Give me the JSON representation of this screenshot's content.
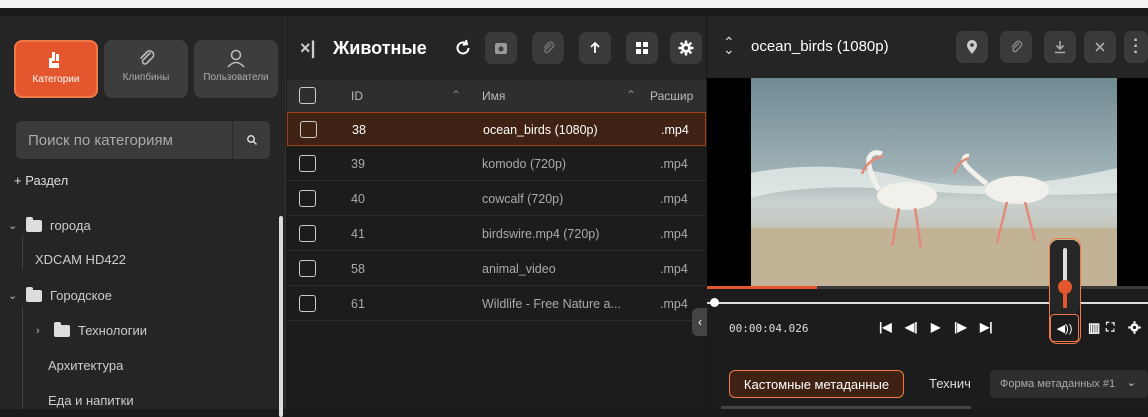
{
  "sidebar": {
    "nav": [
      {
        "label": "Категории",
        "icon": "categories-icon",
        "active": true
      },
      {
        "label": "Клипбины",
        "icon": "paperclip-icon",
        "active": false
      },
      {
        "label": "Пользователи",
        "icon": "user-icon",
        "active": false
      }
    ],
    "search_placeholder": "Поиск по категориям",
    "add_section": "+ Раздел",
    "tree": [
      {
        "label": "города",
        "expanded": true
      },
      {
        "label": "XDCAM HD422"
      },
      {
        "label": "Городское",
        "expanded": true
      },
      {
        "label": "Технологии",
        "expanded": false
      },
      {
        "label": "Архитектура"
      },
      {
        "label": "Еда и напитки"
      }
    ]
  },
  "middle": {
    "title": "Животные",
    "columns": [
      "ID",
      "Имя",
      "Расшир"
    ],
    "rows": [
      {
        "id": "38",
        "name": "ocean_birds (1080p)",
        "ext": ".mp4",
        "selected": true
      },
      {
        "id": "39",
        "name": "komodo (720p)",
        "ext": ".mp4"
      },
      {
        "id": "40",
        "name": "cowcalf (720p)",
        "ext": ".mp4"
      },
      {
        "id": "41",
        "name": "birdswire.mp4 (720p)",
        "ext": ".mp4"
      },
      {
        "id": "58",
        "name": "animal_video",
        "ext": ".mp4"
      },
      {
        "id": "61",
        "name": "Wildlife - Free Nature a...",
        "ext": ".mp4"
      }
    ]
  },
  "player": {
    "title": "ocean_birds (1080p)",
    "timecode": "00:00:04.026",
    "progress_percent": 25,
    "volume_percent": 35
  },
  "meta_tabs": {
    "active": "Кастомные метаданные",
    "second": "Техническ",
    "form_select": "Форма метаданных #1"
  },
  "colors": {
    "accent": "#e4572e",
    "bg": "#1c1c1c"
  }
}
